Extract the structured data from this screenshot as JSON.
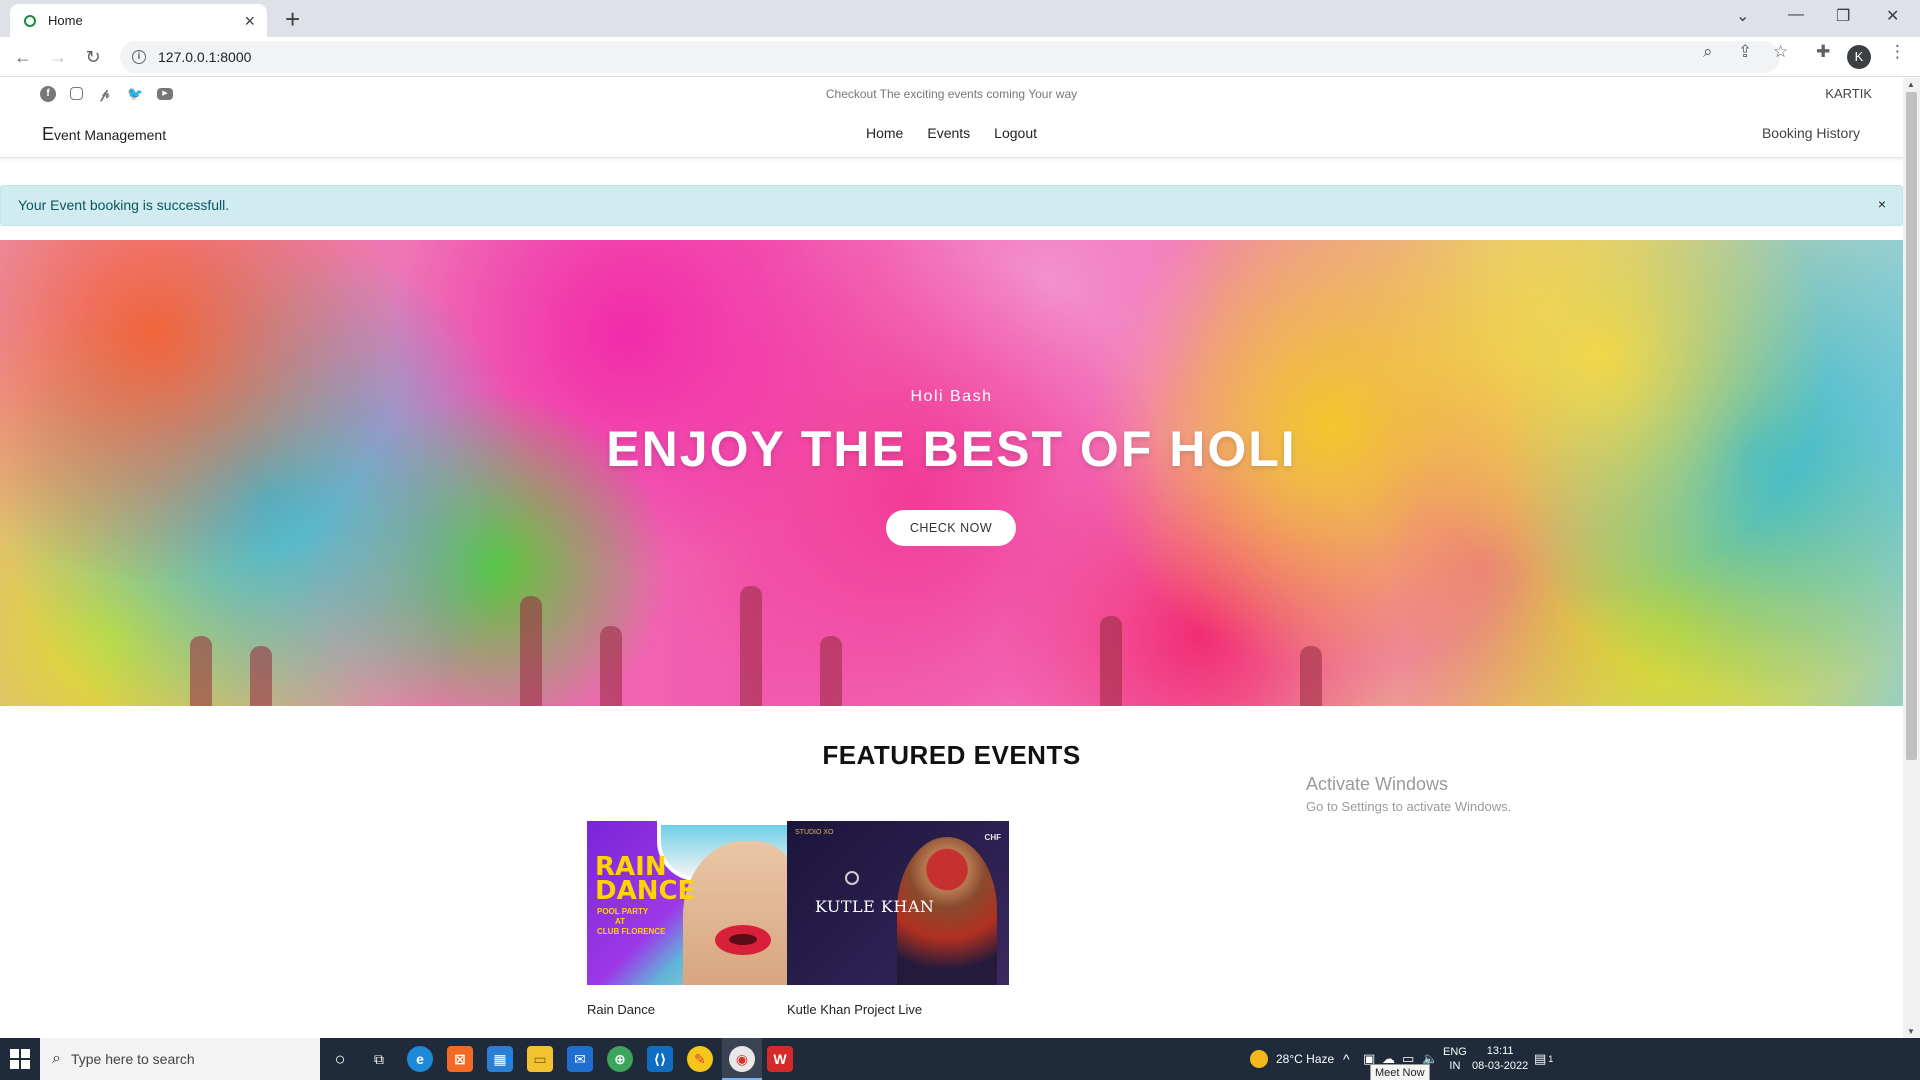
{
  "browser": {
    "tab_title": "Home",
    "new_tab": "+",
    "url": "127.0.0.1:8000",
    "profile_initial": "K"
  },
  "site": {
    "social_icons": [
      "facebook-icon",
      "instagram-icon",
      "pinterest-icon",
      "twitter-icon",
      "youtube-icon"
    ],
    "tagline": "Checkout The exciting events coming Your way",
    "user": "KARTIK",
    "brand_initial": "E",
    "brand_rest": "vent Management",
    "nav": [
      "Home",
      "Events",
      "Logout"
    ],
    "booking_history": "Booking History",
    "alert": {
      "message": "Your Event booking is successfull.",
      "close": "×"
    },
    "hero": {
      "subtitle": "Holi Bash",
      "title": "ENJOY THE BEST OF HOLI",
      "button": "CHECK NOW"
    },
    "featured": {
      "heading": "FEATURED EVENTS",
      "events": [
        {
          "name": "Rain Dance",
          "poster_title": "RAIN DANCE",
          "poster_sub1": "POOL PARTY",
          "poster_sub2": "AT",
          "poster_sub3": "CLUB FLORENCE"
        },
        {
          "name": "Kutle Khan Project Live",
          "poster_brand": "STUDIO XO",
          "poster_tag": "CHF",
          "poster_title": "KUTLE KHAN"
        }
      ]
    }
  },
  "watermark": {
    "line1": "Activate Windows",
    "line2": "Go to Settings to activate Windows."
  },
  "taskbar": {
    "search_placeholder": "Type here to search",
    "weather": "28°C Haze",
    "lang1": "ENG",
    "lang2": "IN",
    "time": "13:11",
    "date": "08-03-2022",
    "notification_count": "1",
    "meet_now": "Meet Now"
  }
}
